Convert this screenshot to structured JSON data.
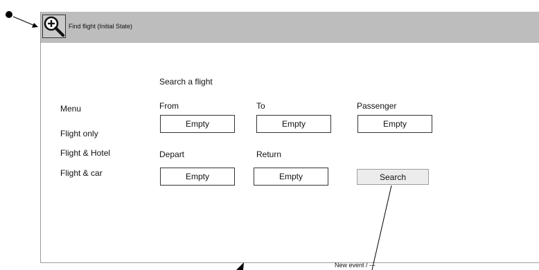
{
  "window": {
    "title": "Find flight  (Initial State)",
    "icon": "zoom-in-magnifier-icon"
  },
  "menu": {
    "heading": "Menu",
    "items": [
      "Flight only",
      "Flight & Hotel",
      "Flight & car"
    ]
  },
  "search": {
    "heading": "Search a flight",
    "from_label": "From",
    "from_value": "Empty",
    "to_label": "To",
    "to_value": "Empty",
    "passenger_label": "Passenger",
    "passenger_value": "Empty",
    "depart_label": "Depart",
    "depart_value": "Empty",
    "return_label": "Return",
    "return_value": "Empty",
    "button_label": "Search"
  },
  "annotation": {
    "event_label": "New event / ---"
  },
  "colors": {
    "title_bar": "#bdbdbd",
    "button_bg": "#ececec",
    "border": "#333333"
  }
}
